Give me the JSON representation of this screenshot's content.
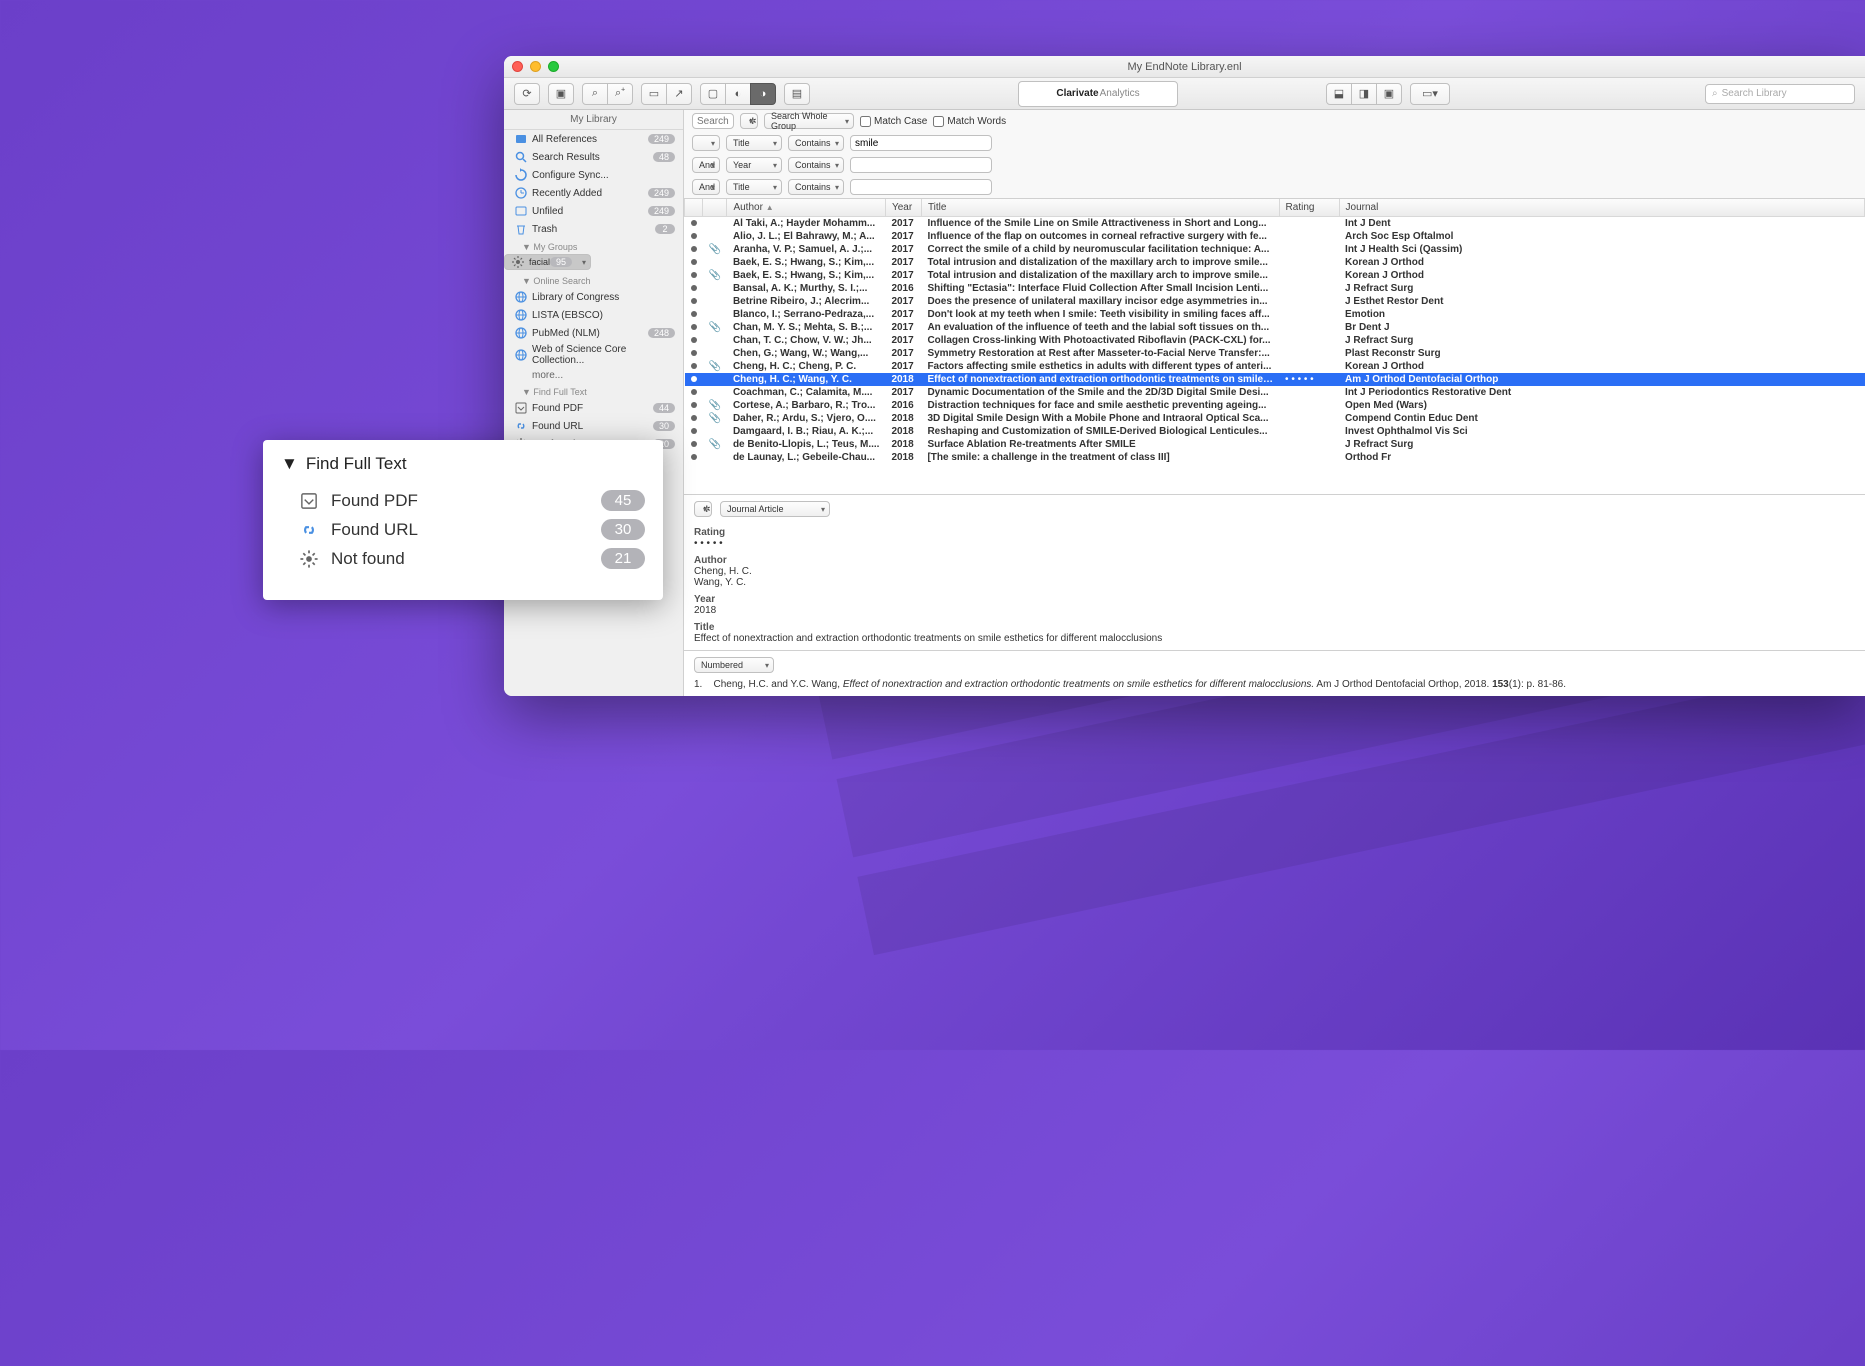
{
  "window": {
    "title": "My EndNote Library.enl",
    "search_placeholder": "Search Library"
  },
  "brand": {
    "name": "Clarivate",
    "sub": "Analytics"
  },
  "sidebar": {
    "header": "My Library",
    "top": [
      {
        "icon": "all",
        "label": "All References",
        "count": "249"
      },
      {
        "icon": "search",
        "label": "Search Results",
        "count": "48"
      },
      {
        "icon": "sync",
        "label": "Configure Sync...",
        "count": ""
      },
      {
        "icon": "clock",
        "label": "Recently Added",
        "count": "249"
      },
      {
        "icon": "unfiled",
        "label": "Unfiled",
        "count": "249"
      },
      {
        "icon": "trash",
        "label": "Trash",
        "count": "2"
      }
    ],
    "groups_header": "My Groups",
    "groups": [
      {
        "icon": "gear",
        "label": "facial",
        "count": "95",
        "selected": true
      }
    ],
    "online_header": "Online Search",
    "online": [
      {
        "icon": "globe",
        "label": "Library of Congress",
        "count": ""
      },
      {
        "icon": "globe",
        "label": "LISTA (EBSCO)",
        "count": ""
      },
      {
        "icon": "globe",
        "label": "PubMed (NLM)",
        "count": "248"
      },
      {
        "icon": "globe",
        "label": "Web of Science Core Collection...",
        "count": ""
      }
    ],
    "more": "more...",
    "fft_header": "Find Full Text",
    "fft": [
      {
        "icon": "pdf",
        "label": "Found PDF",
        "count": "44"
      },
      {
        "icon": "url",
        "label": "Found URL",
        "count": "30"
      },
      {
        "icon": "nf",
        "label": "Not found",
        "count": "20"
      }
    ]
  },
  "search": {
    "label": "Search",
    "scope": "Search Whole Group",
    "match_case": "Match Case",
    "match_words": "Match Words",
    "rows": [
      {
        "op": "",
        "field": "Title",
        "cond": "Contains",
        "val": "smile"
      },
      {
        "op": "And",
        "field": "Year",
        "cond": "Contains",
        "val": ""
      },
      {
        "op": "And",
        "field": "Title",
        "cond": "Contains",
        "val": ""
      }
    ]
  },
  "columns": [
    "",
    "",
    "Author",
    "Year",
    "Title",
    "Rating",
    "Journal"
  ],
  "refs": [
    {
      "a": "Al Taki, A.; Hayder Mohamm...",
      "y": "2017",
      "t": "Influence of the Smile Line on Smile Attractiveness in Short and Long...",
      "j": "Int J Dent",
      "clip": false
    },
    {
      "a": "Alio, J. L.; El Bahrawy, M.; A...",
      "y": "2017",
      "t": "Influence of the flap on outcomes in corneal refractive surgery with fe...",
      "j": "Arch Soc Esp Oftalmol",
      "clip": false
    },
    {
      "a": "Aranha, V. P.; Samuel, A. J.;...",
      "y": "2017",
      "t": "Correct the smile of a child by neuromuscular facilitation technique: A...",
      "j": "Int J Health Sci (Qassim)",
      "clip": true
    },
    {
      "a": "Baek, E. S.; Hwang, S.; Kim,...",
      "y": "2017",
      "t": "Total intrusion and distalization of the maxillary arch to improve smile...",
      "j": "Korean J Orthod",
      "clip": false
    },
    {
      "a": "Baek, E. S.; Hwang, S.; Kim,...",
      "y": "2017",
      "t": "Total intrusion and distalization of the maxillary arch to improve smile...",
      "j": "Korean J Orthod",
      "clip": true
    },
    {
      "a": "Bansal, A. K.; Murthy, S. I.;...",
      "y": "2016",
      "t": "Shifting \"Ectasia\": Interface Fluid Collection After Small Incision Lenti...",
      "j": "J Refract Surg",
      "clip": false
    },
    {
      "a": "Betrine Ribeiro, J.; Alecrim...",
      "y": "2017",
      "t": "Does the presence of unilateral maxillary incisor edge asymmetries in...",
      "j": "J Esthet Restor Dent",
      "clip": false
    },
    {
      "a": "Blanco, I.; Serrano-Pedraza,...",
      "y": "2017",
      "t": "Don't look at my teeth when I smile: Teeth visibility in smiling faces aff...",
      "j": "Emotion",
      "clip": false
    },
    {
      "a": "Chan, M. Y. S.; Mehta, S. B.;...",
      "y": "2017",
      "t": "An evaluation of the influence of teeth and the labial soft tissues on th...",
      "j": "Br Dent J",
      "clip": true
    },
    {
      "a": "Chan, T. C.; Chow, V. W.; Jh...",
      "y": "2017",
      "t": "Collagen Cross-linking With Photoactivated Riboflavin (PACK-CXL) for...",
      "j": "J Refract Surg",
      "clip": false
    },
    {
      "a": "Chen, G.; Wang, W.; Wang,...",
      "y": "2017",
      "t": "Symmetry Restoration at Rest after Masseter-to-Facial Nerve Transfer:...",
      "j": "Plast Reconstr Surg",
      "clip": false
    },
    {
      "a": "Cheng, H. C.; Cheng, P. C.",
      "y": "2017",
      "t": "Factors affecting smile esthetics in adults with different types of anteri...",
      "j": "Korean J Orthod",
      "clip": true
    },
    {
      "a": "Cheng, H. C.; Wang, Y. C.",
      "y": "2018",
      "t": "Effect of nonextraction and extraction orthodontic treatments on smile…",
      "j": "Am J Orthod Dentofacial Orthop",
      "clip": false,
      "selected": true,
      "rating": "• • • • •"
    },
    {
      "a": "Coachman, C.; Calamita, M....",
      "y": "2017",
      "t": "Dynamic Documentation of the Smile and the 2D/3D Digital Smile Desi...",
      "j": "Int J Periodontics Restorative Dent",
      "clip": false
    },
    {
      "a": "Cortese, A.; Barbaro, R.; Tro...",
      "y": "2016",
      "t": "Distraction techniques for face and smile aesthetic preventing ageing...",
      "j": "Open Med (Wars)",
      "clip": true
    },
    {
      "a": "Daher, R.; Ardu, S.; Vjero, O....",
      "y": "2018",
      "t": "3D Digital Smile Design With a Mobile Phone and Intraoral Optical Sca...",
      "j": "Compend Contin Educ Dent",
      "clip": true
    },
    {
      "a": "Damgaard, I. B.; Riau, A. K.;...",
      "y": "2018",
      "t": "Reshaping and Customization of SMILE-Derived Biological Lenticules...",
      "j": "Invest Ophthalmol Vis Sci",
      "clip": false
    },
    {
      "a": "de Benito-Llopis, L.; Teus, M....",
      "y": "2018",
      "t": "Surface Ablation Re-treatments After SMILE",
      "j": "J Refract Surg",
      "clip": true
    },
    {
      "a": "de Launay, L.; Gebeile-Chau...",
      "y": "2018",
      "t": "[The smile: a challenge in the treatment of class III]",
      "j": "Orthod Fr",
      "clip": false
    }
  ],
  "detail": {
    "type": "Journal Article",
    "rating_label": "Rating",
    "rating": "• • • • •",
    "author_label": "Author",
    "authors": [
      "Cheng, H. C.",
      "Wang, Y. C."
    ],
    "year_label": "Year",
    "year": "2018",
    "title_label": "Title",
    "title": "Effect of nonextraction and extraction orthodontic treatments on smile esthetics for different malocclusions"
  },
  "cite": {
    "style": "Numbered",
    "num": "1.",
    "authors": "Cheng, H.C. and Y.C. Wang,",
    "title": "Effect of nonextraction and extraction orthodontic treatments on smile esthetics for different malocclusions.",
    "tail": " Am J Orthod Dentofacial Orthop, 2018. ",
    "vol": "153",
    "pages": "(1): p. 81-86."
  },
  "callout": {
    "title": "Find Full Text",
    "items": [
      {
        "icon": "pdf",
        "label": "Found PDF",
        "count": "45"
      },
      {
        "icon": "url",
        "label": "Found URL",
        "count": "30"
      },
      {
        "icon": "nf",
        "label": "Not found",
        "count": "21"
      }
    ]
  }
}
